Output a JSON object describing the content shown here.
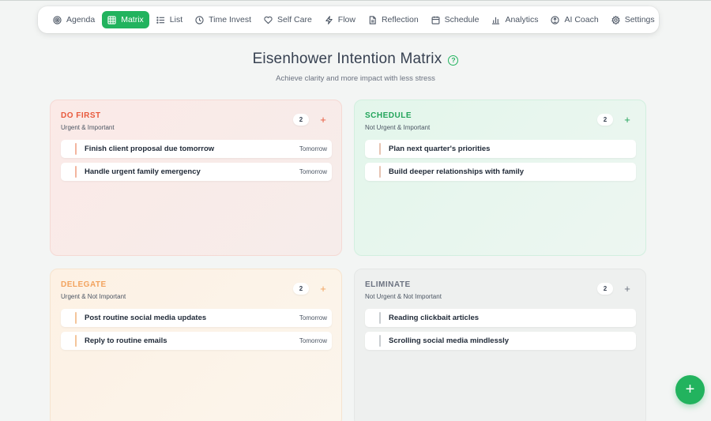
{
  "nav": {
    "items": [
      {
        "label": "Agenda",
        "icon": "target-icon"
      },
      {
        "label": "Matrix",
        "icon": "grid-icon",
        "active": true
      },
      {
        "label": "List",
        "icon": "list-icon"
      },
      {
        "label": "Time Invest",
        "icon": "clock-icon"
      },
      {
        "label": "Self Care",
        "icon": "heart-icon"
      },
      {
        "label": "Flow",
        "icon": "bolt-icon"
      },
      {
        "label": "Reflection",
        "icon": "document-icon"
      },
      {
        "label": "Schedule",
        "icon": "calendar-icon"
      },
      {
        "label": "Analytics",
        "icon": "bar-chart-icon"
      },
      {
        "label": "AI Coach",
        "icon": "coach-icon"
      },
      {
        "label": "Settings",
        "icon": "gear-icon"
      }
    ]
  },
  "header": {
    "title": "Eisenhower Intention Matrix",
    "help_glyph": "?",
    "subtitle": "Achieve clarity and more impact with less stress"
  },
  "quadrants": {
    "do_first": {
      "title": "DO FIRST",
      "subtitle": "Urgent & Important",
      "count": "2",
      "add_glyph": "+",
      "tasks": [
        {
          "text": "Finish client proposal due tomorrow",
          "due": "Tomorrow"
        },
        {
          "text": "Handle urgent family emergency",
          "due": "Tomorrow"
        }
      ]
    },
    "schedule": {
      "title": "SCHEDULE",
      "subtitle": "Not Urgent & Important",
      "count": "2",
      "add_glyph": "+",
      "tasks": [
        {
          "text": "Plan next quarter's priorities",
          "due": ""
        },
        {
          "text": "Build deeper relationships with family",
          "due": ""
        }
      ]
    },
    "delegate": {
      "title": "DELEGATE",
      "subtitle": "Urgent & Not Important",
      "count": "2",
      "add_glyph": "+",
      "tasks": [
        {
          "text": "Post routine social media updates",
          "due": "Tomorrow"
        },
        {
          "text": "Reply to routine emails",
          "due": "Tomorrow"
        }
      ]
    },
    "eliminate": {
      "title": "ELIMINATE",
      "subtitle": "Not Urgent & Not Important",
      "count": "2",
      "add_glyph": "+",
      "tasks": [
        {
          "text": "Reading clickbait articles",
          "due": ""
        },
        {
          "text": "Scrolling social media mindlessly",
          "due": ""
        }
      ]
    }
  },
  "fab": {
    "glyph": "+"
  },
  "colors": {
    "accent": "#22b35e",
    "do_first": "#e8593c",
    "schedule": "#22a45a",
    "delegate": "#f2a35e",
    "eliminate": "#6b7280"
  }
}
